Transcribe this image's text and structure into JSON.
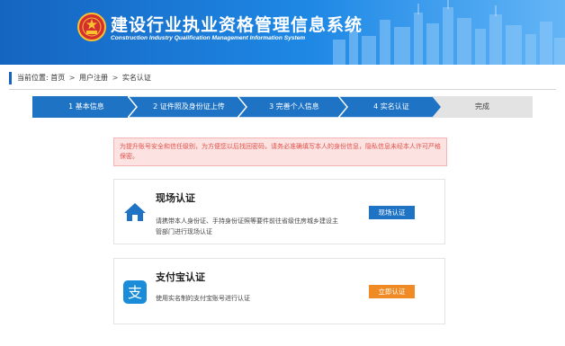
{
  "header": {
    "title_cn": "建设行业执业资格管理信息系统",
    "title_en": "Construction Industry Qualification Management Information System",
    "emblem_icon": "national-emblem-icon",
    "bg_color": "#1e88e5"
  },
  "breadcrumb": {
    "prefix": "当前位置:",
    "items": [
      "首页",
      "用户注册",
      "实名认证"
    ],
    "separator": ">"
  },
  "steps": [
    {
      "label": "1 基本信息",
      "state": "done"
    },
    {
      "label": "2 证件照及身份证上传",
      "state": "done"
    },
    {
      "label": "3 完善个人信息",
      "state": "done"
    },
    {
      "label": "4 实名认证",
      "state": "current"
    },
    {
      "label": "完成",
      "state": "pending"
    }
  ],
  "notice": {
    "text": "为提升账号安全和信任级别，为方便您以后找回密码，请务必准确填写本人的身份信息，隐私信息未经本人许可严格保密。",
    "color": "#e0534a"
  },
  "methods": [
    {
      "icon": "home-icon",
      "title": "现场认证",
      "desc_line1": "请携带本人身份证、手持身份证照等要件前往省级住房城乡建设主",
      "desc_line2": "管部门进行现场认证",
      "button": "现场认证",
      "button_color": "#1e73c4"
    },
    {
      "icon": "alipay-icon",
      "title": "支付宝认证",
      "desc_line1": "使用实名制的支付宝账号进行认证",
      "button": "立即认证",
      "button_color": "#f08a24"
    }
  ]
}
